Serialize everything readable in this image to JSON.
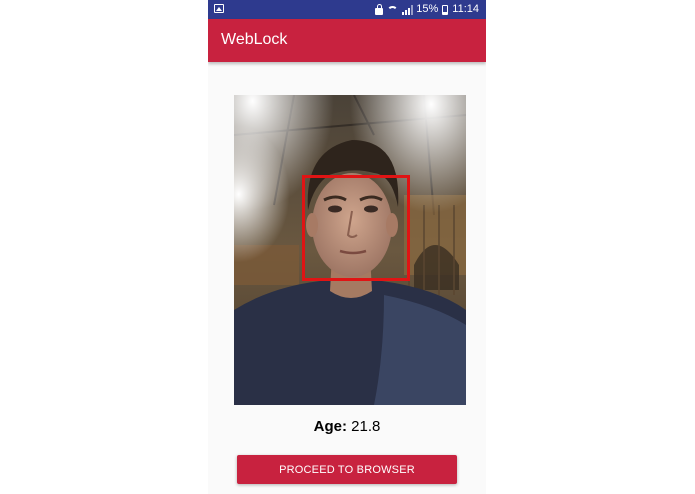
{
  "status_bar": {
    "battery_percent": "15%",
    "time": "11:14",
    "icons": [
      "image-notification-icon",
      "lock-icon",
      "wifi-icon",
      "signal-icon",
      "battery-icon"
    ]
  },
  "app_bar": {
    "title": "WebLock"
  },
  "photo": {
    "description_icon": "camera-photo",
    "face_detected": true,
    "face_box_color": "#e01414"
  },
  "result": {
    "age_label": "Age:",
    "age_value": "21.8"
  },
  "actions": {
    "proceed_label": "PROCEED TO BROWSER"
  },
  "colors": {
    "accent": "#c8223f",
    "status_bar": "#2e3a8e",
    "background": "#fafafa"
  }
}
